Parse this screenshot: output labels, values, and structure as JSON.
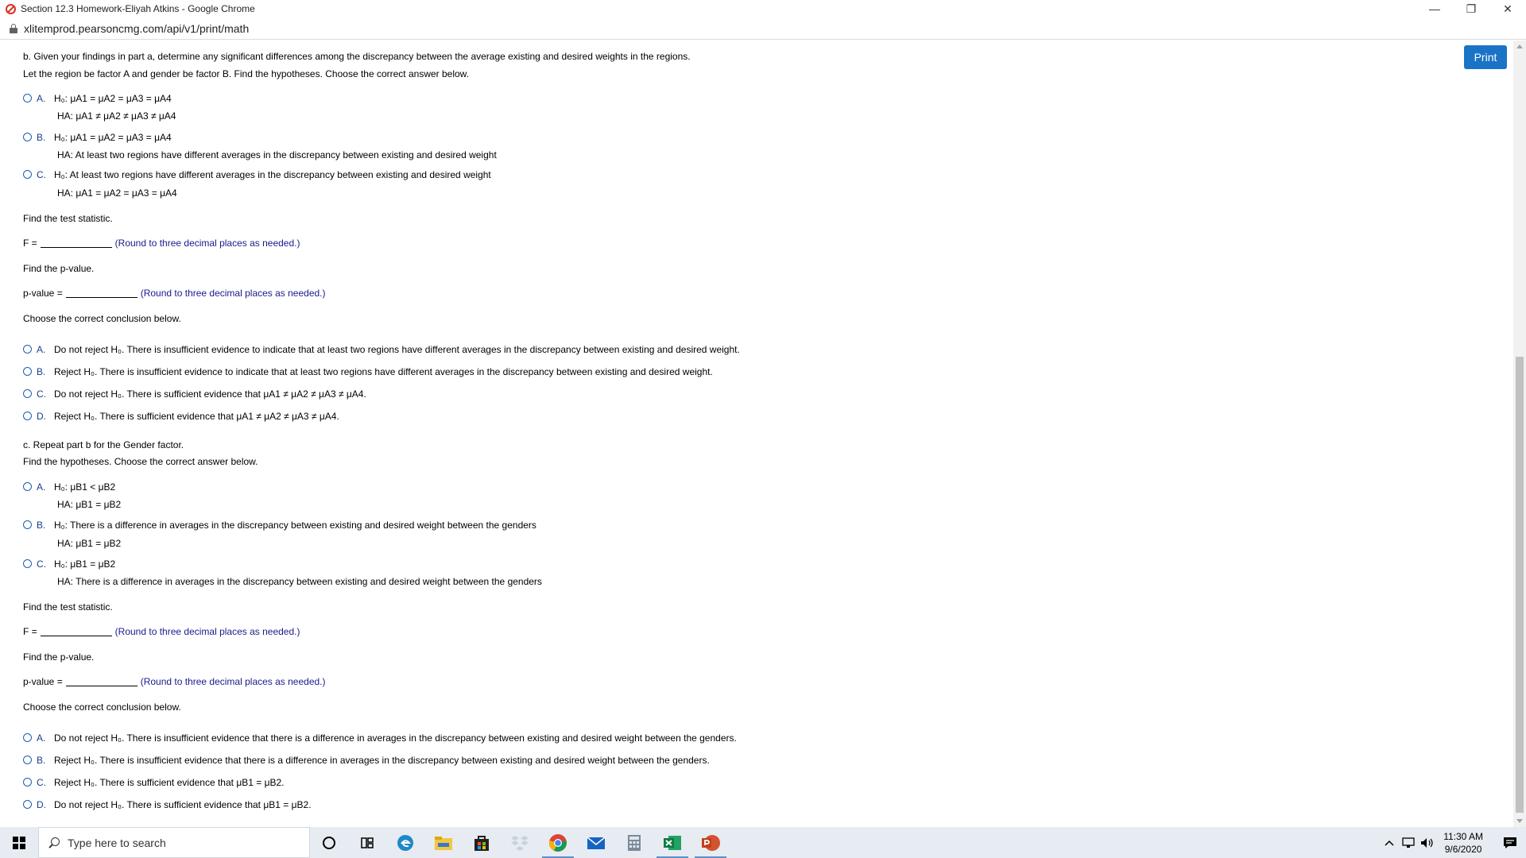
{
  "window": {
    "title": "Section 12.3 Homework-Eliyah Atkins - Google Chrome",
    "url": "xlitemprod.pearsoncmg.com/api/v1/print/math",
    "controls": {
      "minimize": "—",
      "restore": "❐",
      "close": "✕"
    }
  },
  "toolbar": {
    "print_label": "Print"
  },
  "part_b": {
    "intro1": "b. Given your findings in part a, determine any significant differences among the discrepancy between the average existing and desired weights in the regions.",
    "intro2": "Let the region be factor A and gender be factor B. Find the hypotheses. Choose the correct answer below.",
    "hyp_options": [
      {
        "letter": "A.",
        "h0": "H₀: μA1 = μA2 = μA3 = μA4",
        "ha": "HA: μA1 ≠ μA2 ≠ μA3 ≠ μA4"
      },
      {
        "letter": "B.",
        "h0": "H₀: μA1 = μA2 = μA3 = μA4",
        "ha": "HA: At least two regions have different averages in the discrepancy between existing and desired weight"
      },
      {
        "letter": "C.",
        "h0": "H₀: At least two regions have different averages in the discrepancy between existing and desired weight",
        "ha": "HA: μA1 = μA2 = μA3 = μA4"
      }
    ],
    "test_stat_prompt": "Find the test statistic.",
    "f_label": "F =",
    "f_hint": "(Round to three decimal places as needed.)",
    "pvalue_prompt": "Find the p-value.",
    "pvalue_label": "p-value =",
    "pvalue_hint": "(Round to three decimal places as needed.)",
    "conclusion_prompt": "Choose the correct conclusion below.",
    "conclusions": [
      {
        "letter": "A.",
        "text": "Do not reject H₀. There is insufficient evidence to indicate that at least two regions have different averages in the discrepancy between existing and desired weight."
      },
      {
        "letter": "B.",
        "text": "Reject H₀. There is insufficient evidence to indicate that at least two regions have different averages in the discrepancy between existing and desired weight."
      },
      {
        "letter": "C.",
        "text": "Do not reject H₀. There is sufficient evidence that μA1 ≠ μA2 ≠ μA3 ≠ μA4."
      },
      {
        "letter": "D.",
        "text": "Reject H₀. There is sufficient evidence that μA1 ≠ μA2 ≠ μA3 ≠ μA4."
      }
    ]
  },
  "part_c": {
    "intro1": "c. Repeat part b for the Gender factor.",
    "intro2": "Find the hypotheses. Choose the correct answer below.",
    "hyp_options": [
      {
        "letter": "A.",
        "h0": "H₀: μB1 < μB2",
        "ha": "HA: μB1 = μB2"
      },
      {
        "letter": "B.",
        "h0": "H₀: There is a difference in averages in the discrepancy between existing and desired weight between the genders",
        "ha": "HA: μB1 = μB2"
      },
      {
        "letter": "C.",
        "h0": "H₀: μB1 = μB2",
        "ha": "HA: There is a difference in averages in the discrepancy between existing and desired weight between the genders"
      }
    ],
    "test_stat_prompt": "Find the test statistic.",
    "f_label": "F =",
    "f_hint": "(Round to three decimal places as needed.)",
    "pvalue_prompt": "Find the p-value.",
    "pvalue_label": "p-value =",
    "pvalue_hint": "(Round to three decimal places as needed.)",
    "conclusion_prompt": "Choose the correct conclusion below.",
    "conclusions": [
      {
        "letter": "A.",
        "text": "Do not reject H₀. There is insufficient evidence that there is a difference in averages in the discrepancy between existing and desired weight between the genders."
      },
      {
        "letter": "B.",
        "text": "Reject H₀. There is insufficient evidence that there is a difference in averages in the discrepancy between existing and desired weight between the genders."
      },
      {
        "letter": "C.",
        "text": "Reject H₀. There is sufficient evidence that μB1 = μB2."
      },
      {
        "letter": "D.",
        "text": "Do not reject H₀. There is sufficient evidence that μB1 = μB2."
      }
    ]
  },
  "taskbar": {
    "search_placeholder": "Type here to search",
    "time": "11:30 AM",
    "date": "9/6/2020"
  }
}
